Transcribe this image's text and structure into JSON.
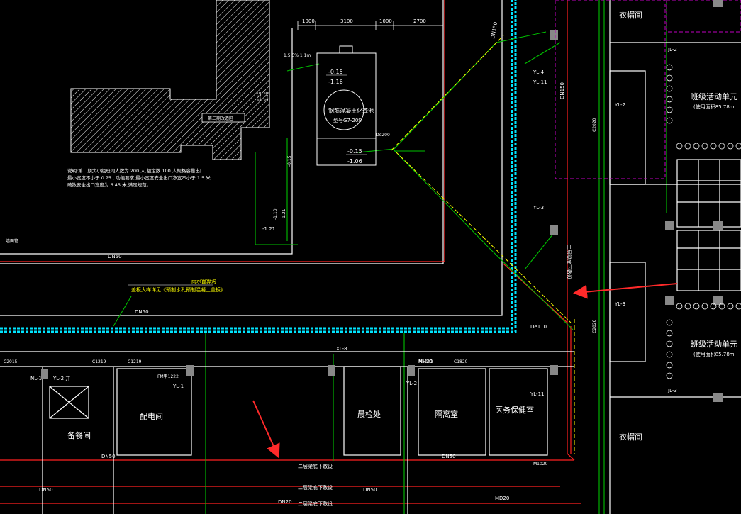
{
  "colors": {
    "background": "#000000",
    "wall": "#ffffff",
    "rain_pipe": "#ff2020",
    "sewer_pipe": "#00c000",
    "trench": "#00e5ff",
    "annotation": "#ffffff",
    "highlight_arrow": "#ff2a2a",
    "room_boundary": "#c000c0",
    "yellow_pipe": "#ffff00"
  },
  "dimensions": [
    "1000",
    "3100",
    "1000",
    "2700"
  ],
  "septic_tank": {
    "label": "钢筋混凝土化粪池",
    "model": "型号G7-20S",
    "levels_top": [
      "-0.15",
      "-1.16"
    ],
    "levels_bottom": [
      "-0.15",
      "-1.06"
    ]
  },
  "hatched_building": {
    "label": "第二期改造区"
  },
  "notes": {
    "line1": "说明:第二期大小组班同人数为       200   人,额定数    100   人规格容量出口",
    "line2": "最小宽度不小于    0.75    , 功能要求,最小宽度安全出口净宽不小于          1.5    米,",
    "line3": "疏散安全出口宽度为      6.45    米,满足规范。"
  },
  "rain_tag": {
    "line1": "雨水篦箅沟",
    "line2": "盖板大样详见《预制水孔预制混凝土盖板》"
  },
  "pipe_labels": {
    "dn50_upper": "DN50",
    "dn50_middle": "DN50",
    "dn50_lower": "DN50",
    "dn50_bottom": "DN50",
    "dn150_vertical": "DN150",
    "dn150_diag": "DN150",
    "de110": "De110",
    "de200": "De200",
    "md20": "MD20",
    "mh20": "MH20",
    "dn20": "DN20"
  },
  "floor_notes": {
    "mid": "二层梁底下敷设",
    "bottom1": "二层梁底下敷设",
    "bottom2": "二层梁底下敷设",
    "vertical": "二层梁底下敷设"
  },
  "risers": [
    "YL-4",
    "YL-11",
    "YL-3",
    "YL-2",
    "YL-1",
    "YL-11",
    "XL-8",
    "JL-2",
    "JL-3",
    "NL-1",
    "YL-2"
  ],
  "doors": [
    "M1021",
    "C1820",
    "C1219",
    "C1219",
    "C2015",
    "FM甲1222",
    "M1020",
    "C2020",
    "C2020"
  ],
  "rooms": {
    "standby": "备餐间",
    "distribution": "配电间",
    "morning_check": "晨检处",
    "isolation": "隔离室",
    "medical": "医务保健室",
    "cloakroom_top": "衣帽间",
    "cloakroom_bottom": "衣帽间",
    "class_unit_1": "班级活动单元",
    "class_unit_1_area": "(使用面积85.78m",
    "class_unit_2": "班级活动单元",
    "class_unit_2_area": "(使用面积85.78m",
    "well_label": "YL-2 井"
  },
  "small_levels": [
    "-0.15",
    "-1.16",
    "-1.21",
    "-0.15",
    "-1.06",
    "-1.10",
    "-1.21"
  ],
  "misc": {
    "stair_note": "1.5 5% 1.1m",
    "wall_pipe": "墙面管"
  }
}
